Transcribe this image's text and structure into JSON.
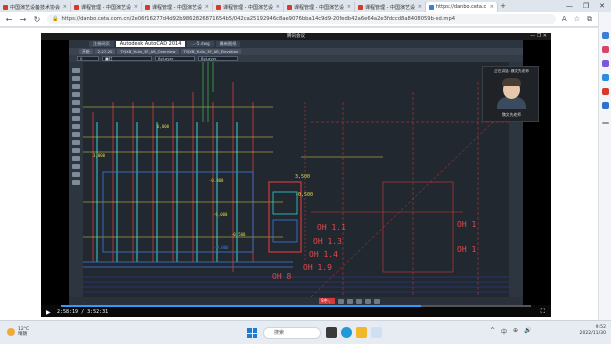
{
  "browser": {
    "tabs": [
      {
        "label": "中国演艺设备技术协会"
      },
      {
        "label": "课程管理 - 中国演艺设"
      },
      {
        "label": "课程管理 - 中国演艺设"
      },
      {
        "label": "课程管理 - 中国演艺设"
      },
      {
        "label": "课程管理 - 中国演艺设"
      },
      {
        "label": "课程管理 - 中国演艺设"
      },
      {
        "label": "https://danbo.ceta.c",
        "active": true
      }
    ],
    "new_tab": "+",
    "window_controls": [
      "—",
      "❐",
      "✕"
    ],
    "url": "https://danbo.ceta.com.cn/2e06f16277d4d92b9862826871654b5/042ca25192946c8ae9076bba14c9d9-20fedb42a6e64a2e3fdccd8a8408059b-sd.mp4",
    "nav": [
      "←",
      "→",
      "↻"
    ],
    "right_icons": [
      "A",
      "☆",
      "⧉",
      "…"
    ]
  },
  "player": {
    "meeting_title": "腾讯会议",
    "time_current": "2:58:19",
    "time_total": "3:52:31",
    "progress_fraction": 0.767,
    "play_icon": "▶",
    "fullscreen_icon": "⛶"
  },
  "remote": {
    "top_tabs": [
      "注册网页",
      "Autodesk AutoCAD 2014",
      "...-5.dwg",
      "最新图纸"
    ],
    "acad_tabs": [
      "开始",
      "2-27-20",
      "TYJXB_Yulin_3F_AR_Overview",
      "TYJXB_Yulin_3F_AR_Elevation"
    ],
    "layer_combo": "0",
    "color_combo": "■红",
    "linetype_combo": "ByLayer",
    "lineweight_combo": "ByLayer",
    "drawing_labels": {
      "elev_6000": "6,000",
      "elev_4500": "3,000",
      "elev_n800": "-0.800",
      "elev_n2600": "-9,000",
      "elev_n4500": "-0,500",
      "elev_n9000": "-9,000",
      "elev_3500": "3,500",
      "elev_0500": "-0,500",
      "oh_11": "OH 1.1",
      "oh_13": "OH 1.3",
      "oh_14": "OH 1.4",
      "oh_19": "OH 1.9",
      "oh_8": "OH 8",
      "oh_r1": "OH 1",
      "oh_r2": "OH 1"
    },
    "cmd_ime": "S中·、"
  },
  "webcam": {
    "title": "正在讲话: 魏文先老师",
    "name": "魏文先老师"
  },
  "taskbar": {
    "weather_temp": "12°C",
    "weather_text": "晴朗",
    "search_placeholder": "搜索",
    "tray_icons": [
      "^",
      "中",
      "⊕",
      "🔊"
    ],
    "time": "9:52",
    "date": "2022/11/30"
  }
}
